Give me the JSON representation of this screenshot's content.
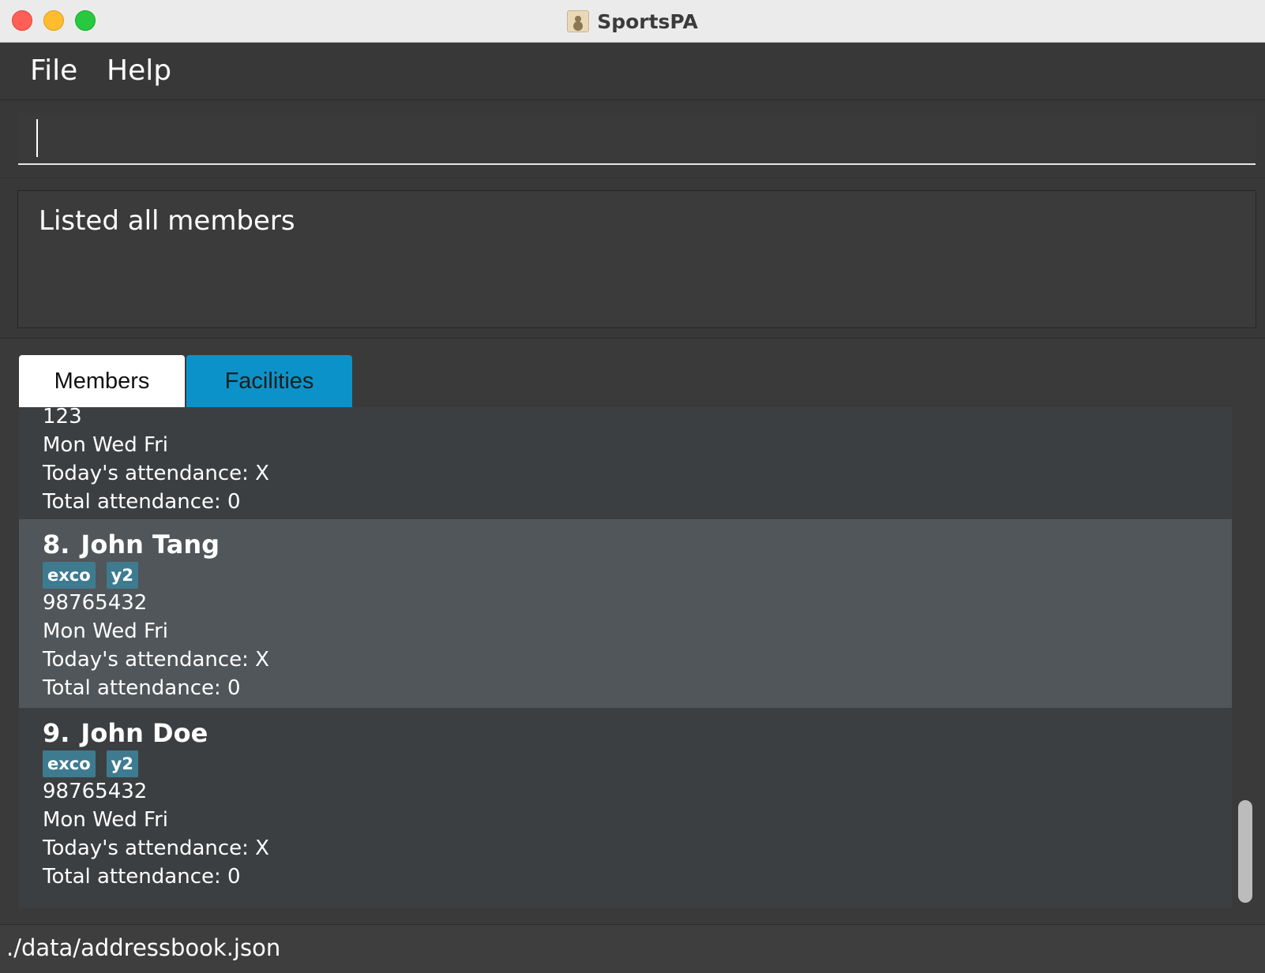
{
  "window": {
    "title": "SportsPA",
    "app_icon": "address-book-icon"
  },
  "menu": {
    "items": [
      {
        "label": "File"
      },
      {
        "label": "Help"
      }
    ]
  },
  "command_box": {
    "value": "",
    "placeholder": ""
  },
  "result_display": {
    "message": "Listed all members"
  },
  "tabs": [
    {
      "label": "Members",
      "selected": true
    },
    {
      "label": "Facilities",
      "selected": false
    }
  ],
  "members": [
    {
      "index": "",
      "name": "",
      "tags": [],
      "phone": "123",
      "availability": "Mon Wed Fri",
      "todays_attendance": "Today's attendance: X",
      "total_attendance": "Total attendance: 0",
      "partially_visible": true
    },
    {
      "index": "8.",
      "name": "John Tang",
      "tags": [
        "exco",
        "y2"
      ],
      "phone": "98765432",
      "availability": "Mon Wed Fri",
      "todays_attendance": "Today's attendance: X",
      "total_attendance": "Total attendance: 0",
      "selected": true
    },
    {
      "index": "9.",
      "name": "John Doe",
      "tags": [
        "exco",
        "y2"
      ],
      "phone": "98765432",
      "availability": "Mon Wed Fri",
      "todays_attendance": "Today's attendance: X",
      "total_attendance": "Total attendance: 0"
    }
  ],
  "status_bar": {
    "file_path": "./data/addressbook.json"
  },
  "colors": {
    "accent_tab": "#0b93c9",
    "tag_bg": "#3e7b91",
    "selected_row": "#50565a",
    "background": "#3a3a3a"
  }
}
